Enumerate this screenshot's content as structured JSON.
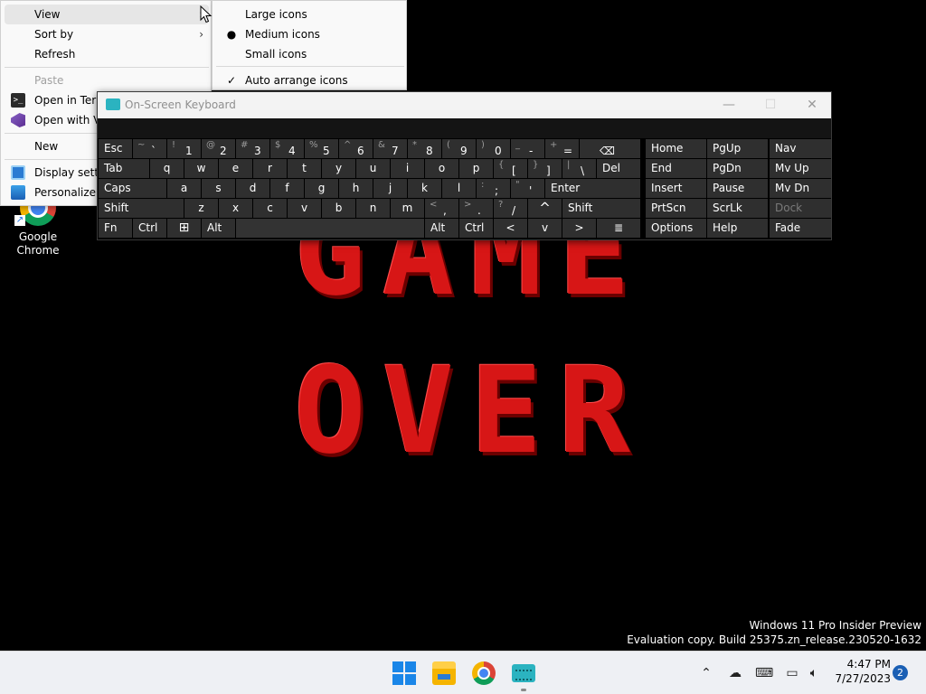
{
  "wallpaper": {
    "line1": "GAME",
    "line2": "OVER"
  },
  "desktop_icons": [
    {
      "label": "Google Chrome",
      "icon": "chrome-icon"
    }
  ],
  "watermark": {
    "line1": "Windows 11 Pro Insider Preview",
    "line2": "Evaluation copy. Build 25375.zn_release.230520-1632"
  },
  "context_menu": {
    "view": "View",
    "sort_by": "Sort by",
    "refresh": "Refresh",
    "paste": "Paste",
    "open_terminal": "Open in Term",
    "open_vs": "Open with Vi",
    "new": "New",
    "display_settings": "Display settin",
    "personalize": "Personalize"
  },
  "view_submenu": {
    "large": "Large icons",
    "medium": "Medium icons",
    "small": "Small icons",
    "auto_arrange": "Auto arrange icons",
    "selected": "Medium icons"
  },
  "osk": {
    "title": "On-Screen Keyboard",
    "row1": {
      "esc": "Esc",
      "tilde": {
        "shift": "~",
        "base": "`"
      },
      "n1": {
        "shift": "!",
        "base": "1"
      },
      "n2": {
        "shift": "@",
        "base": "2"
      },
      "n3": {
        "shift": "#",
        "base": "3"
      },
      "n4": {
        "shift": "$",
        "base": "4"
      },
      "n5": {
        "shift": "%",
        "base": "5"
      },
      "n6": {
        "shift": "^",
        "base": "6"
      },
      "n7": {
        "shift": "&",
        "base": "7"
      },
      "n8": {
        "shift": "*",
        "base": "8"
      },
      "n9": {
        "shift": "(",
        "base": "9"
      },
      "n0": {
        "shift": ")",
        "base": "0"
      },
      "minus": {
        "shift": "_",
        "base": "-"
      },
      "equals": {
        "shift": "+",
        "base": "="
      },
      "backspace": "⌫",
      "home": "Home",
      "pgup": "PgUp",
      "nav": "Nav"
    },
    "row2": {
      "tab": "Tab",
      "q": "q",
      "w": "w",
      "e": "e",
      "r": "r",
      "t": "t",
      "y": "y",
      "u": "u",
      "i": "i",
      "o": "o",
      "p": "p",
      "lbracket": {
        "shift": "{",
        "base": "["
      },
      "rbracket": {
        "shift": "}",
        "base": "]"
      },
      "backslash": {
        "shift": "|",
        "base": "\\"
      },
      "del": "Del",
      "end": "End",
      "pgdn": "PgDn",
      "mvup": "Mv Up"
    },
    "row3": {
      "caps": "Caps",
      "a": "a",
      "s": "s",
      "d": "d",
      "f": "f",
      "g": "g",
      "h": "h",
      "j": "j",
      "k": "k",
      "l": "l",
      "semicolon": {
        "shift": ":",
        "base": ";"
      },
      "quote": {
        "shift": "\"",
        "base": "'"
      },
      "enter": "Enter",
      "insert": "Insert",
      "pause": "Pause",
      "mvdn": "Mv Dn"
    },
    "row4": {
      "shift_l": "Shift",
      "z": "z",
      "x": "x",
      "c": "c",
      "v": "v",
      "b": "b",
      "n": "n",
      "m": "m",
      "comma": {
        "shift": "<",
        "base": ","
      },
      "period": {
        "shift": ">",
        "base": "."
      },
      "slash": {
        "shift": "?",
        "base": "/"
      },
      "up": "^",
      "shift_r": "Shift",
      "prtscn": "PrtScn",
      "scrlk": "ScrLk",
      "dock": "Dock"
    },
    "row5": {
      "fn": "Fn",
      "ctrl_l": "Ctrl",
      "win": "⊞",
      "alt_l": "Alt",
      "alt_r": "Alt",
      "ctrl_r": "Ctrl",
      "left": "<",
      "down": "v",
      "right": ">",
      "menu": "≣",
      "options": "Options",
      "help": "Help",
      "fade": "Fade"
    }
  },
  "taskbar": {
    "apps": [
      "start-icon",
      "file-explorer-icon",
      "chrome-icon",
      "on-screen-keyboard-icon"
    ],
    "time": "4:47 PM",
    "date": "7/27/2023",
    "notification_count": "2"
  },
  "colors": {
    "accent": "#1a86e8",
    "game_over_red": "#d71616",
    "osk_key": "#2f2f2f",
    "taskbar": "#eef0f4"
  }
}
